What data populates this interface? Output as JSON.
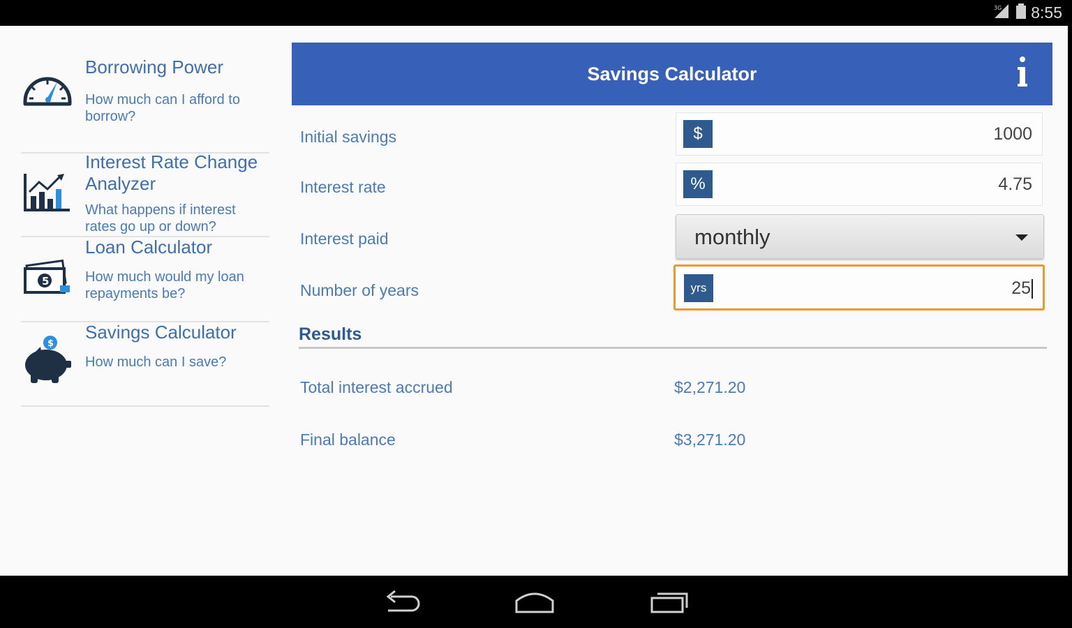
{
  "status_bar": {
    "time": "8:55"
  },
  "sidebar": {
    "items": [
      {
        "title": "Borrowing Power",
        "desc": "How much can I afford to borrow?",
        "icon": "speedometer-icon"
      },
      {
        "title": "Interest Rate Change Analyzer",
        "desc": "What happens if interest rates go up or down?",
        "icon": "chart-icon"
      },
      {
        "title": "Loan Calculator",
        "desc": "How much would my loan repayments be?",
        "icon": "money-icon"
      },
      {
        "title": "Savings Calculator",
        "desc": "How much can I save?",
        "icon": "piggy-bank-icon"
      }
    ]
  },
  "main": {
    "title": "Savings Calculator",
    "info_icon": "info-icon",
    "fields": {
      "initial_savings": {
        "label": "Initial savings",
        "prefix": "$",
        "value": "1000"
      },
      "interest_rate": {
        "label": "Interest rate",
        "prefix": "%",
        "value": "4.75"
      },
      "interest_paid": {
        "label": "Interest paid",
        "value": "monthly"
      },
      "years": {
        "label": "Number of years",
        "prefix": "yrs",
        "value": "25"
      }
    },
    "results": {
      "title": "Results",
      "total_interest": {
        "label": "Total interest accrued",
        "value": "$2,271.20"
      },
      "final_balance": {
        "label": "Final balance",
        "value": "$3,271.20"
      }
    }
  },
  "colors": {
    "header_blue": "#3760b8",
    "text_blue": "#4b7bb7",
    "focus_orange": "#f0982a",
    "prefix_navy": "#2e5a8e"
  },
  "nav_bar": {
    "buttons": [
      "back-icon",
      "home-icon",
      "recents-icon"
    ]
  }
}
